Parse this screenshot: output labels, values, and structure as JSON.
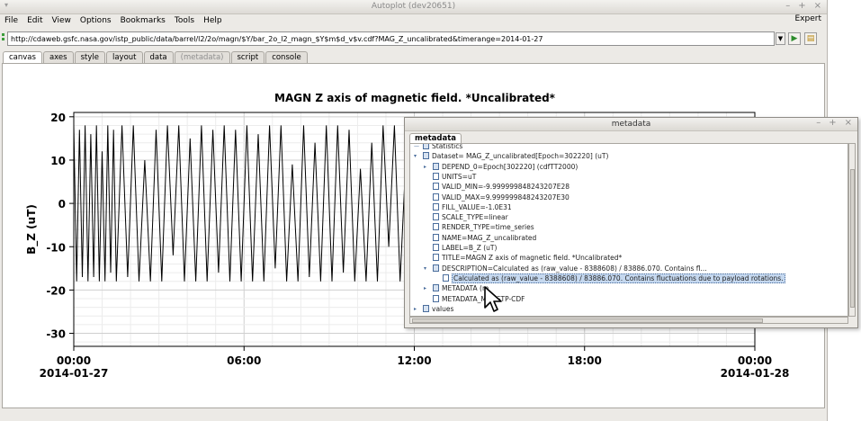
{
  "window": {
    "title": "Autoplot (dev20651)",
    "controls": [
      "–",
      "+",
      "×"
    ]
  },
  "menu": {
    "items": [
      "File",
      "Edit",
      "View",
      "Options",
      "Bookmarks",
      "Tools",
      "Help"
    ],
    "expert_label": "Expert"
  },
  "url_bar": {
    "value": "http://cdaweb.gsfc.nasa.gov/istp_public/data/barrel/l2/2o/magn/$Y/bar_2o_l2_magn_$Y$m$d_v$v.cdf?MAG_Z_uncalibrated&timerange=2014-01-27",
    "dropdown_icon": "chevron-down-icon",
    "go_icon": "play-icon",
    "browse_icon": "folder-icon"
  },
  "tabs": [
    {
      "label": "canvas",
      "state": "active"
    },
    {
      "label": "axes",
      "state": "normal"
    },
    {
      "label": "style",
      "state": "normal"
    },
    {
      "label": "layout",
      "state": "normal"
    },
    {
      "label": "data",
      "state": "normal"
    },
    {
      "label": "(metadata)",
      "state": "disabled"
    },
    {
      "label": "script",
      "state": "normal"
    },
    {
      "label": "console",
      "state": "normal"
    }
  ],
  "chart_data": {
    "type": "line",
    "title": "MAGN  Z axis of magnetic field. *Uncalibrated*",
    "ylabel": "B_Z (uT)",
    "xlabel": "",
    "ylim": [
      -33,
      21
    ],
    "yticks": [
      20,
      10,
      0,
      -10,
      -20,
      -30
    ],
    "xticks": [
      {
        "label": "00:00",
        "label2": "2014-01-27",
        "x": 0
      },
      {
        "label": "06:00",
        "label2": "",
        "x": 6
      },
      {
        "label": "12:00",
        "label2": "",
        "x": 12
      },
      {
        "label": "18:00",
        "label2": "",
        "x": 18
      },
      {
        "label": "00:00",
        "label2": "2014-01-28",
        "x": 24
      }
    ],
    "xlim": [
      0,
      24
    ],
    "grid": true,
    "series": [
      {
        "color": "#000000",
        "x": [
          0.0,
          0.1,
          0.2,
          0.3,
          0.4,
          0.5,
          0.6,
          0.7,
          0.8,
          0.9,
          1.0,
          1.1,
          1.2,
          1.3,
          1.4,
          1.5,
          1.7,
          1.9,
          2.1,
          2.3,
          2.5,
          2.7,
          2.9,
          3.1,
          3.3,
          3.5,
          3.7,
          3.9,
          4.1,
          4.3,
          4.5,
          4.7,
          4.9,
          5.1,
          5.3,
          5.5,
          5.7,
          5.9,
          6.1,
          6.3,
          6.5,
          6.7,
          6.9,
          7.1,
          7.3,
          7.5,
          7.7,
          7.9,
          8.1,
          8.3,
          8.5,
          8.7,
          8.9,
          9.1,
          9.3,
          9.5,
          9.7,
          9.9,
          10.1,
          10.3,
          10.5,
          10.7,
          10.9,
          11.1,
          11.3,
          11.5,
          11.7,
          11.9
        ],
        "y": [
          18,
          -18,
          17,
          -17,
          18,
          -18,
          16,
          -17,
          18,
          -18,
          12,
          -18,
          18,
          -16,
          17,
          -18,
          18,
          -17,
          18,
          -18,
          10,
          -18,
          17,
          -18,
          18,
          -12,
          18,
          -18,
          15,
          -18,
          18,
          -18,
          17,
          -16,
          18,
          -18,
          17,
          -18,
          18,
          -18,
          16,
          -18,
          18,
          -15,
          18,
          -18,
          9,
          -18,
          18,
          -17,
          14,
          -18,
          18,
          -18,
          18,
          -16,
          17,
          -18,
          8,
          -18,
          14,
          -18,
          18,
          -10,
          18,
          -18,
          10,
          -18
        ]
      }
    ]
  },
  "metadata_window": {
    "title": "metadata",
    "controls": [
      "–",
      "+",
      "×"
    ],
    "tab_label": "metadata",
    "nodes": [
      {
        "text": "Statistics",
        "indent": 0,
        "icon": "folder-icon",
        "handle": "—"
      },
      {
        "text": "Dataset= MAG_Z_uncalibrated[Epoch=302220] (uT)",
        "indent": 0,
        "icon": "folder-icon",
        "handle": "▾"
      },
      {
        "text": "DEPEND_0=Epoch[302220] (cdfTT2000)",
        "indent": 1,
        "icon": "folder-icon",
        "handle": "▸"
      },
      {
        "text": "UNITS=uT",
        "indent": 1,
        "icon": "file-icon",
        "handle": ""
      },
      {
        "text": "VALID_MIN=-9.999999848243207E28",
        "indent": 1,
        "icon": "file-icon",
        "handle": ""
      },
      {
        "text": "VALID_MAX=9.999999848243207E30",
        "indent": 1,
        "icon": "file-icon",
        "handle": ""
      },
      {
        "text": "FILL_VALUE=-1.0E31",
        "indent": 1,
        "icon": "file-icon",
        "handle": ""
      },
      {
        "text": "SCALE_TYPE=linear",
        "indent": 1,
        "icon": "file-icon",
        "handle": ""
      },
      {
        "text": "RENDER_TYPE=time_series",
        "indent": 1,
        "icon": "file-icon",
        "handle": ""
      },
      {
        "text": "NAME=MAG_Z_uncalibrated",
        "indent": 1,
        "icon": "file-icon",
        "handle": ""
      },
      {
        "text": "LABEL=B_Z (uT)",
        "indent": 1,
        "icon": "file-icon",
        "handle": ""
      },
      {
        "text": "TITLE=MAGN  Z axis of magnetic field. *Uncalibrated*",
        "indent": 1,
        "icon": "file-icon",
        "handle": ""
      },
      {
        "text": "DESCRIPTION=Calculated as (raw_value - 8388608) / 83886.070. Contains fl...",
        "indent": 1,
        "icon": "folder-icon",
        "handle": "▾"
      },
      {
        "text": "Calculated as (raw_value - 8388608) / 83886.070. Contains fluctuations due to payload rotations.",
        "indent": 2,
        "icon": "file-icon",
        "handle": "",
        "selected": true
      },
      {
        "text": "METADATA (m",
        "indent": 1,
        "icon": "folder-icon",
        "handle": "▸"
      },
      {
        "text": "METADATA_M     =ISTP-CDF",
        "indent": 1,
        "icon": "file-icon",
        "handle": ""
      },
      {
        "text": "values",
        "indent": 0,
        "icon": "folder-icon",
        "handle": "▸"
      }
    ]
  }
}
